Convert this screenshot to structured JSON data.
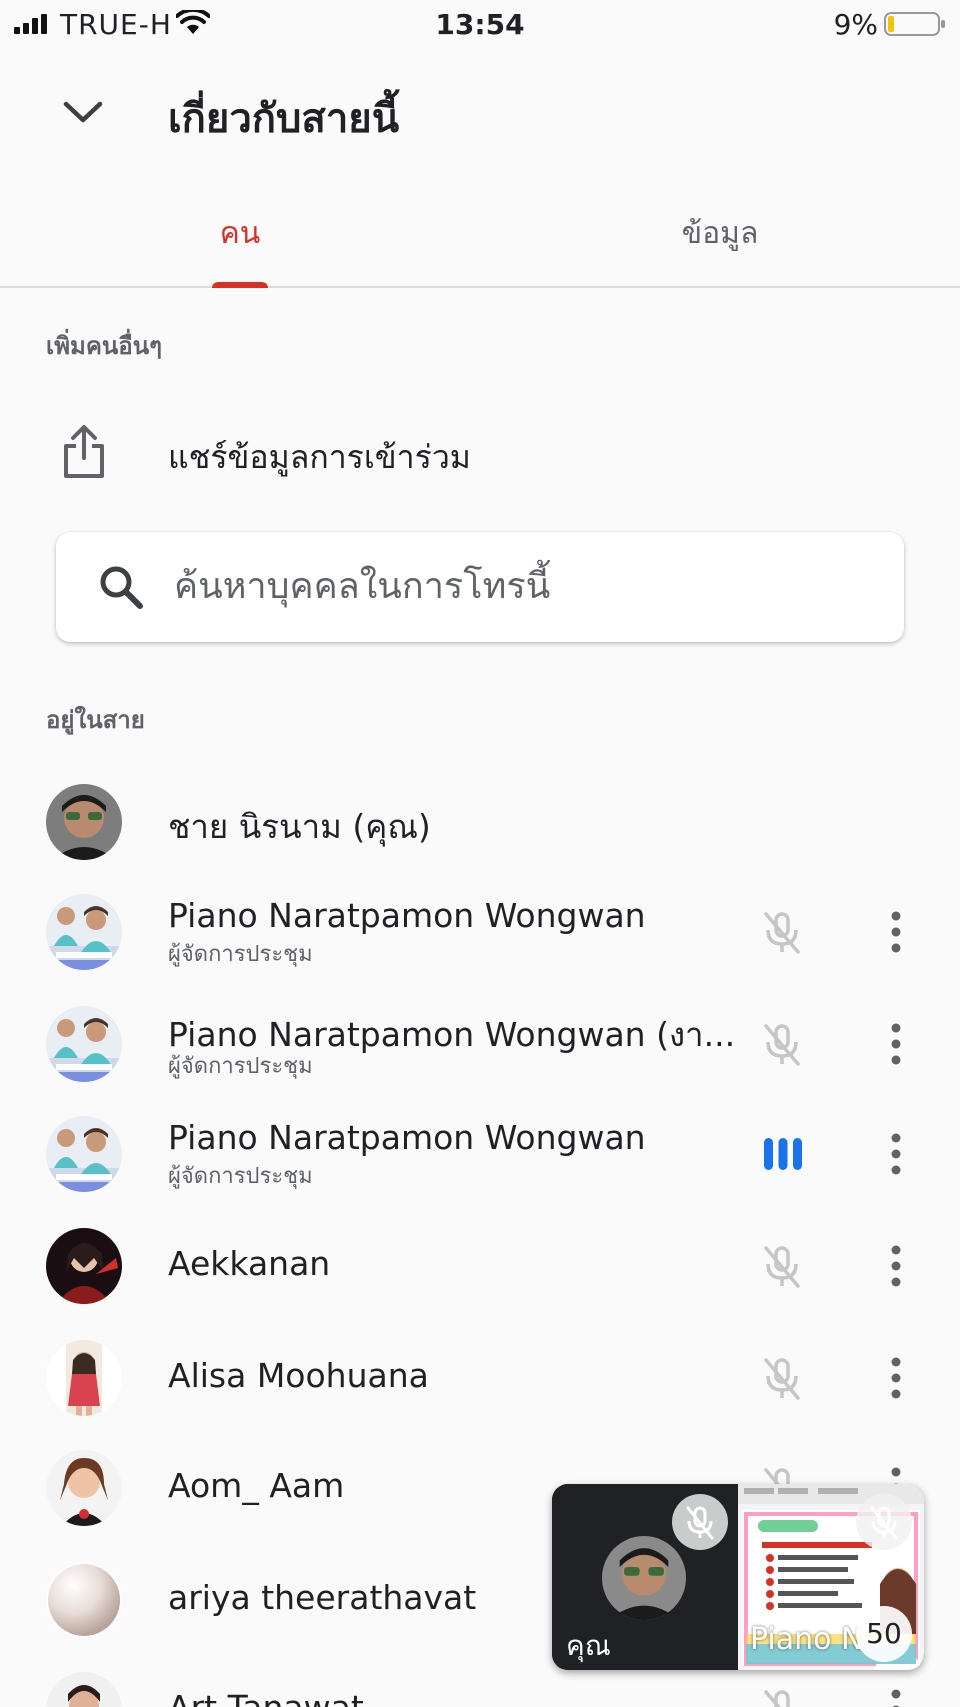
{
  "status_bar": {
    "carrier": "TRUE-H",
    "time": "13:54",
    "battery": "9%"
  },
  "header": {
    "title": "เกี่ยวกับสายนี้"
  },
  "tabs": [
    {
      "label": "คน",
      "active": true
    },
    {
      "label": "ข้อมูล",
      "active": false
    }
  ],
  "add_people": {
    "section_label": "เพิ่มคนอื่นๆ",
    "share_label": "แชร์ข้อมูลการเข้าร่วม"
  },
  "search": {
    "placeholder": "ค้นหาบุคคลในการโทรนี้",
    "value": ""
  },
  "in_call": {
    "section_label": "อยู่ในสาย",
    "participants": [
      {
        "name": "ชาย นิรนาม (คุณ)",
        "role": "",
        "mic": "none",
        "avatar": "self"
      },
      {
        "name": "Piano Naratpamon Wongwan",
        "role": "ผู้จัดการประชุม",
        "mic": "muted",
        "avatar": "teacher"
      },
      {
        "name": "Piano Naratpamon Wongwan (งา...",
        "role": "ผู้จัดการประชุม",
        "mic": "muted",
        "avatar": "teacher"
      },
      {
        "name": "Piano Naratpamon Wongwan",
        "role": "ผู้จัดการประชุม",
        "mic": "speaking",
        "avatar": "teacher"
      },
      {
        "name": "Aekkanan",
        "role": "",
        "mic": "muted",
        "avatar": "anime"
      },
      {
        "name": "Alisa Moohuana",
        "role": "",
        "mic": "muted",
        "avatar": "girl"
      },
      {
        "name": "Aom_ Aam",
        "role": "",
        "mic": "muted",
        "avatar": "woman"
      },
      {
        "name": "ariya theerathavat",
        "role": "",
        "mic": "muted",
        "avatar": "pearl"
      },
      {
        "name": "Art Tanawat",
        "role": "",
        "mic": "muted",
        "avatar": "man"
      }
    ]
  },
  "preview": {
    "self_label": "คุณ",
    "other_label": "Piano N...",
    "participant_count": "50"
  },
  "colors": {
    "accent_red": "#d93025",
    "speaking_blue": "#1a73e8",
    "muted_gray": "#c4c7c5"
  },
  "icons": {
    "back": "chevron-down-icon",
    "share": "share-icon",
    "search": "search-icon",
    "mic_off": "mic-off-icon",
    "speaking": "audio-level-icon",
    "more": "more-vert-icon"
  }
}
